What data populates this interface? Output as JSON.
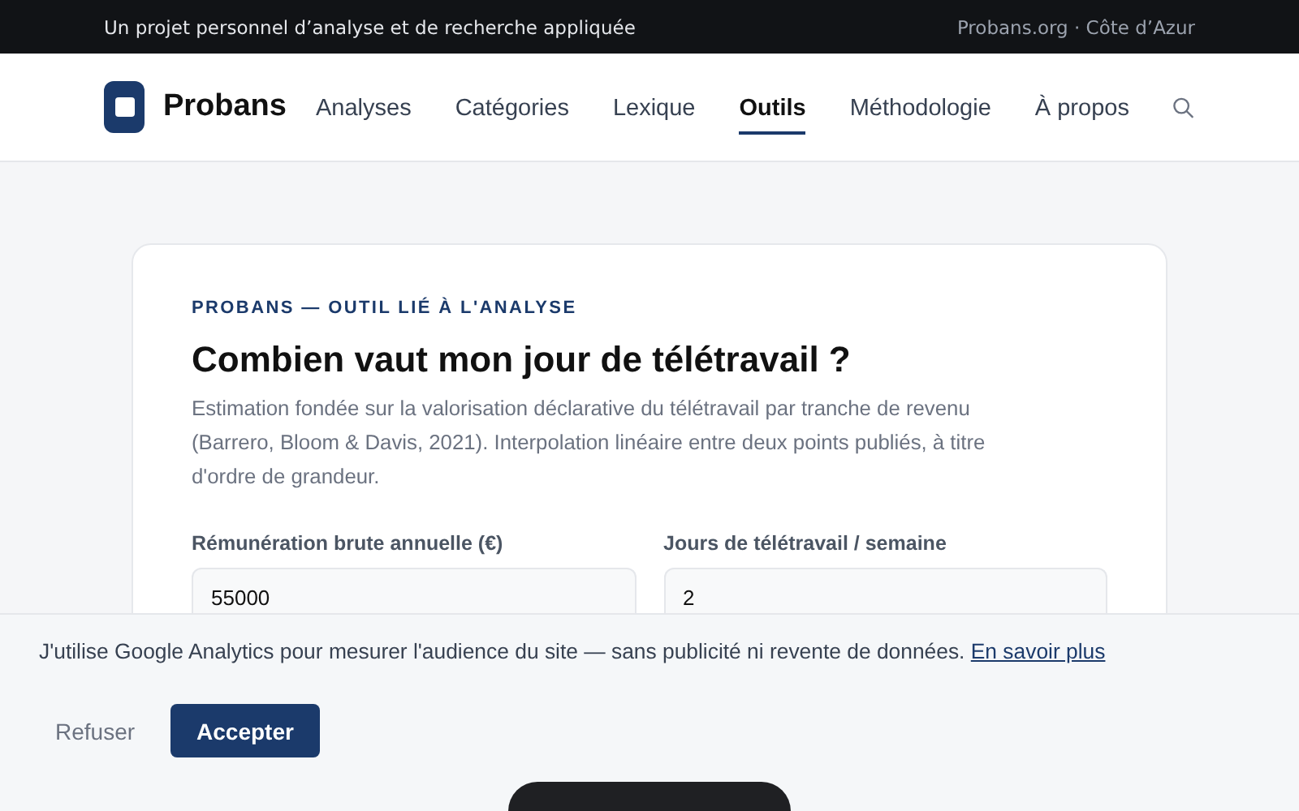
{
  "topbar": {
    "tagline": "Un projet personnel d’analyse et de recherche appliquée",
    "site": "Probans.org · Côte d’Azur"
  },
  "nav": {
    "brand": "Probans",
    "items": [
      {
        "label": "Analyses",
        "selected": false
      },
      {
        "label": "Catégories",
        "selected": false
      },
      {
        "label": "Lexique",
        "selected": false
      },
      {
        "label": "Outils",
        "selected": true
      },
      {
        "label": "Méthodologie",
        "selected": false
      },
      {
        "label": "À propos",
        "selected": false
      }
    ]
  },
  "card": {
    "eyebrow": "PROBANS — OUTIL LIÉ À L'ANALYSE",
    "title": "Combien vaut mon jour de télétravail ?",
    "intro": "Estimation fondée sur la valorisation déclarative du télétravail par tranche de revenu (Barrero, Bloom & Davis, 2021). Interpolation linéaire entre deux points publiés, à titre d'ordre de grandeur.",
    "fields": [
      {
        "label": "Rémunération brute annuelle (€)",
        "value": "55000"
      },
      {
        "label": "Jours de télétravail / semaine",
        "value": "2"
      }
    ]
  },
  "cookie_banner": {
    "text": "J'utilise Google Analytics pour mesurer l'audience du site — sans publicité ni revente de données.",
    "link": "En savoir plus",
    "buttons": [
      {
        "label": "Refuser",
        "kind": "secondary"
      },
      {
        "label": "Accepter",
        "kind": "primary"
      }
    ]
  }
}
